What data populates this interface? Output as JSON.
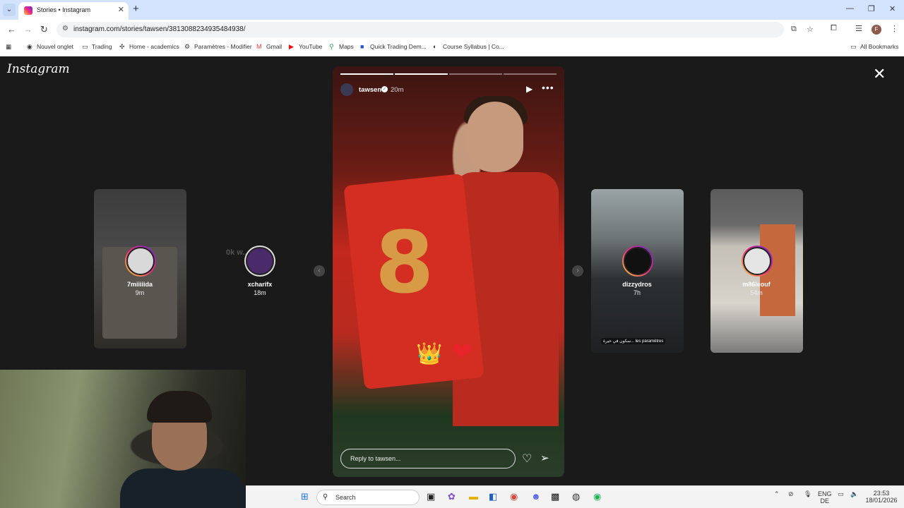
{
  "browser": {
    "tab_title": "Stories • Instagram",
    "new_tab_symbol": "+",
    "url": "instagram.com/stories/tawsen/3813088234935484938/",
    "window_controls": {
      "minimize": "—",
      "restore": "❐",
      "close": "✕"
    },
    "bookmarks": [
      {
        "label": "Nouvel onglet",
        "icon": "globe-icon"
      },
      {
        "label": "Trading",
        "icon": "folder-icon"
      },
      {
        "label": "Home - academics",
        "icon": "app-icon"
      },
      {
        "label": "Paramètres - Modifier",
        "icon": "gear-icon"
      },
      {
        "label": "Gmail",
        "icon": "gmail-icon"
      },
      {
        "label": "YouTube",
        "icon": "youtube-icon"
      },
      {
        "label": "Maps",
        "icon": "maps-icon"
      },
      {
        "label": "Quick Trading Dem...",
        "icon": "app-icon"
      },
      {
        "label": "Course Syllabus | Co...",
        "icon": "app-icon"
      }
    ],
    "all_bookmarks": "All Bookmarks",
    "profile_initial": "F"
  },
  "instagram": {
    "logo": "Instagram",
    "left_stories": [
      {
        "username": "7miiiiida",
        "time": "9m"
      },
      {
        "username": "xcharifx",
        "time": "18m",
        "overlay_text": "0k w... rhba"
      }
    ],
    "right_stories": [
      {
        "username": "dizzydros",
        "time": "7h",
        "caption": "سكون في حيرة... les paramètres"
      },
      {
        "username": "m86leouf",
        "time": "54m"
      }
    ],
    "current_story": {
      "username": "tawsen",
      "time": "20m",
      "progress_segments": 4,
      "progress_done": 2,
      "jersey_number": "8",
      "reply_placeholder": "Reply to tawsen...",
      "emoji_crown": "👑",
      "emoji_heart": "❤"
    }
  },
  "taskbar": {
    "search_label": "Search",
    "lang_top": "ENG",
    "lang_bottom": "DE",
    "time": "23:53",
    "date": "18/01/2026"
  },
  "colors": {
    "accent": "#d3e3fd",
    "story_red": "#c2281d",
    "ig_ring": "#ee2a7b"
  }
}
